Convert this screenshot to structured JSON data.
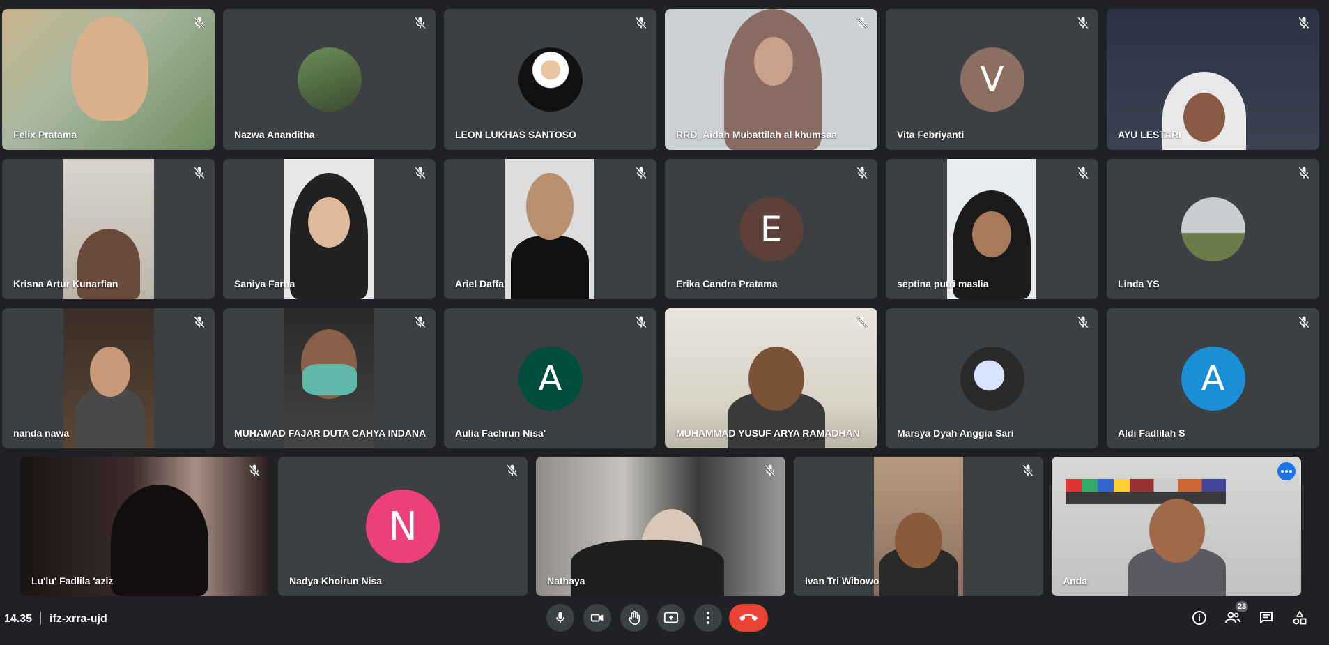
{
  "participants": [
    {
      "name": "Felix Pratama"
    },
    {
      "name": "Nazwa Ananditha"
    },
    {
      "name": "LEON LUKHAS SANTOSO"
    },
    {
      "name": "RRD_Aidah Mubattilah al khumsaa"
    },
    {
      "name": "Vita Febriyanti",
      "initial": "V",
      "avatar_color": "#8d6e63"
    },
    {
      "name": "AYU LESTARI"
    },
    {
      "name": "Krisna Artur Kunarfian"
    },
    {
      "name": "Saniya Farha"
    },
    {
      "name": "Ariel Daffa"
    },
    {
      "name": "Erika Candra Pratama",
      "initial": "E",
      "avatar_color": "#5d4037"
    },
    {
      "name": "septina putri maslia"
    },
    {
      "name": "Linda YS"
    },
    {
      "name": "nanda nawa"
    },
    {
      "name": "MUHAMAD FAJAR DUTA CAHYA INDANA"
    },
    {
      "name": "Aulia Fachrun Nisa'",
      "initial": "A",
      "avatar_color": "#004d40"
    },
    {
      "name": "MUHAMMAD YUSUF ARYA RAMADHAN"
    },
    {
      "name": "Marsya Dyah Anggia Sari"
    },
    {
      "name": "Aldi Fadlilah S",
      "initial": "A",
      "avatar_color": "#1a8fd8"
    },
    {
      "name": "Lu'lu' Fadlila 'aziz"
    },
    {
      "name": "Nadya Khoirun Nisa",
      "initial": "N",
      "avatar_color": "#ec407a"
    },
    {
      "name": "Nathaya"
    },
    {
      "name": "Ivan Tri Wibowo"
    },
    {
      "name": "Anda"
    }
  ],
  "bottom_bar": {
    "time": "14.35",
    "meeting_code": "ifz-xrra-ujd",
    "controls": [
      {
        "icon": "microphone-icon"
      },
      {
        "icon": "camera-icon"
      },
      {
        "icon": "raise-hand-icon"
      },
      {
        "icon": "present-screen-icon"
      },
      {
        "icon": "more-options-icon"
      },
      {
        "icon": "end-call-icon"
      }
    ],
    "participants_count": "23",
    "right_icons": [
      "info-icon",
      "people-icon",
      "chat-icon",
      "activities-icon"
    ]
  }
}
